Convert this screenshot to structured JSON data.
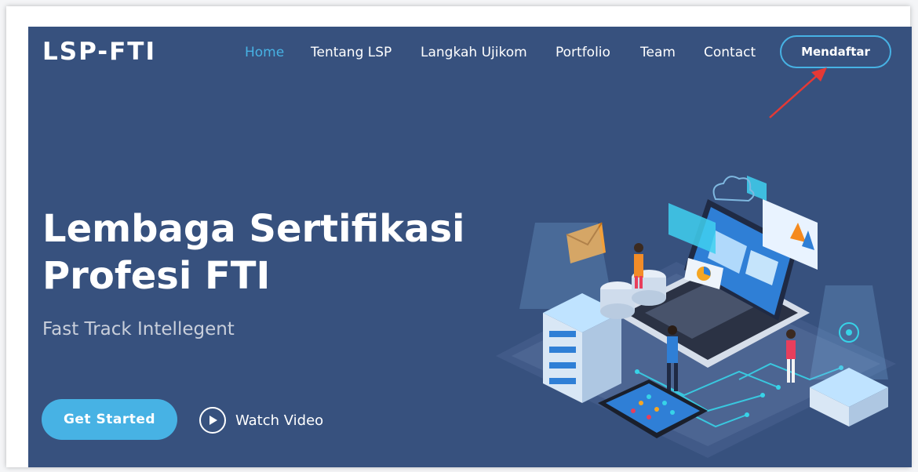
{
  "brand": {
    "name": "LSP-FTI"
  },
  "nav": {
    "items": [
      {
        "label": "Home",
        "active": true
      },
      {
        "label": "Tentang LSP",
        "active": false
      },
      {
        "label": "Langkah Ujikom",
        "active": false
      },
      {
        "label": "Portfolio",
        "active": false
      },
      {
        "label": "Team",
        "active": false
      },
      {
        "label": "Contact",
        "active": false
      }
    ],
    "cta_label": "Mendaftar"
  },
  "hero": {
    "title_line1": "Lembaga Sertifikasi",
    "title_line2": "Profesi FTI",
    "subtitle": "Fast Track Intellegent",
    "primary_button": "Get Started",
    "video_button": "Watch Video"
  },
  "colors": {
    "hero_bg": "#37517e",
    "accent": "#47b2e4",
    "annotation_arrow": "#e53935"
  }
}
